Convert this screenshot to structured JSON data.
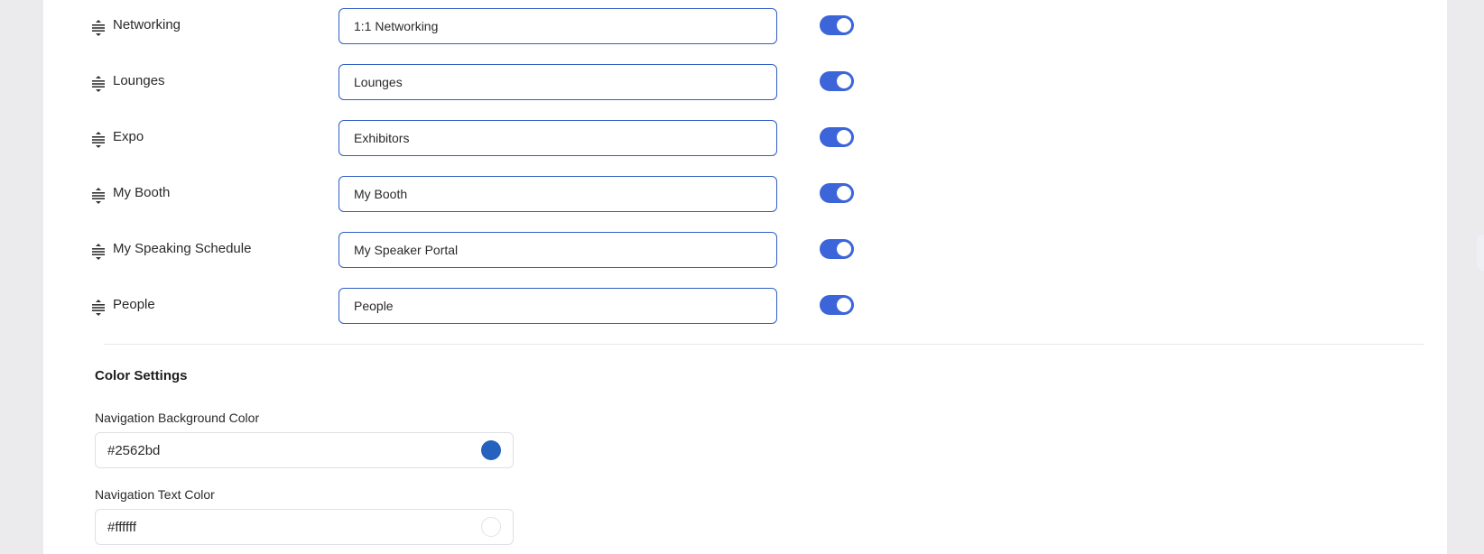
{
  "nav_items": [
    {
      "name": "Networking",
      "value": "1:1 Networking",
      "enabled": true
    },
    {
      "name": "Lounges",
      "value": "Lounges",
      "enabled": true
    },
    {
      "name": "Expo",
      "value": "Exhibitors",
      "enabled": true
    },
    {
      "name": "My Booth",
      "value": "My Booth",
      "enabled": true
    },
    {
      "name": "My Speaking Schedule",
      "value": "My Speaker Portal",
      "enabled": true
    },
    {
      "name": "People",
      "value": "People",
      "enabled": true
    }
  ],
  "color_settings": {
    "title": "Color Settings",
    "nav_bg": {
      "label": "Navigation Background Color",
      "value": "#2562bd",
      "swatch": "#2562bd"
    },
    "nav_text": {
      "label": "Navigation Text Color",
      "value": "#ffffff",
      "swatch": "#ffffff"
    }
  },
  "icons": {
    "drag": "drag-handle-icon"
  },
  "colors": {
    "accent": "#3b65d9",
    "input_border": "#2f5fc4"
  }
}
